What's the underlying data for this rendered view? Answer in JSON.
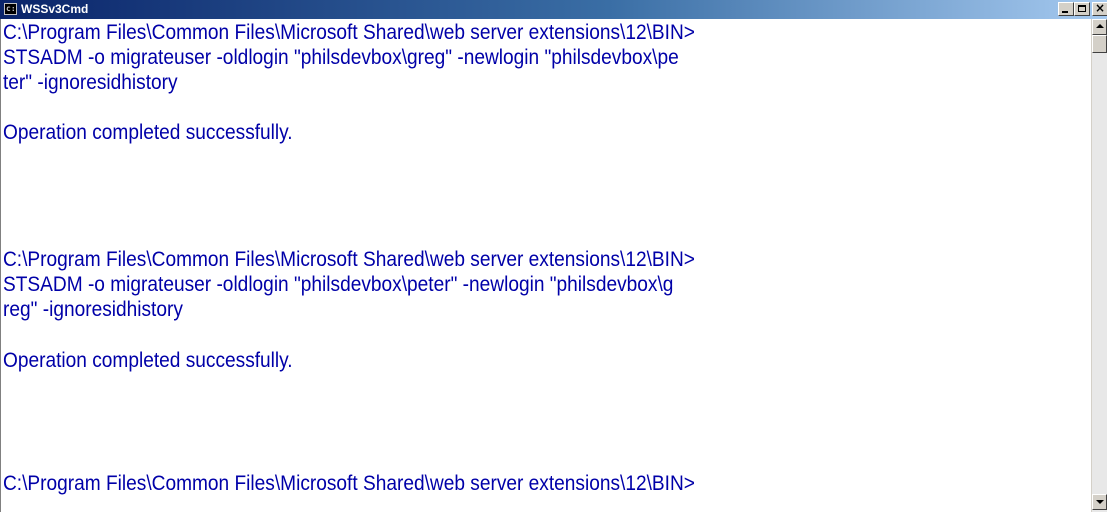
{
  "window": {
    "title": "WSSv3Cmd",
    "icon": "console-icon",
    "icon_text": "c:\\",
    "controls": {
      "minimize": "minimize-icon",
      "maximize": "maximize-icon",
      "close_glyph": "×"
    }
  },
  "console": {
    "text_color": "#0000a8",
    "background": "#ffffff",
    "lines": [
      "C:\\Program Files\\Common Files\\Microsoft Shared\\web server extensions\\12\\BIN>",
      "STSADM -o migrateuser -oldlogin \"philsdevbox\\greg\" -newlogin \"philsdevbox\\pe",
      "ter\" -ignoresidhistory",
      "",
      "Operation completed successfully.",
      "",
      "",
      "C:\\Program Files\\Common Files\\Microsoft Shared\\web server extensions\\12\\BIN>",
      "STSADM -o migrateuser -oldlogin \"philsdevbox\\peter\" -newlogin \"philsdevbox\\g",
      "reg\" -ignoresidhistory",
      "",
      "Operation completed successfully.",
      "",
      "",
      "C:\\Program Files\\Common Files\\Microsoft Shared\\web server extensions\\12\\BIN>"
    ]
  },
  "scrollbar": {
    "position_fraction": 0.0
  }
}
